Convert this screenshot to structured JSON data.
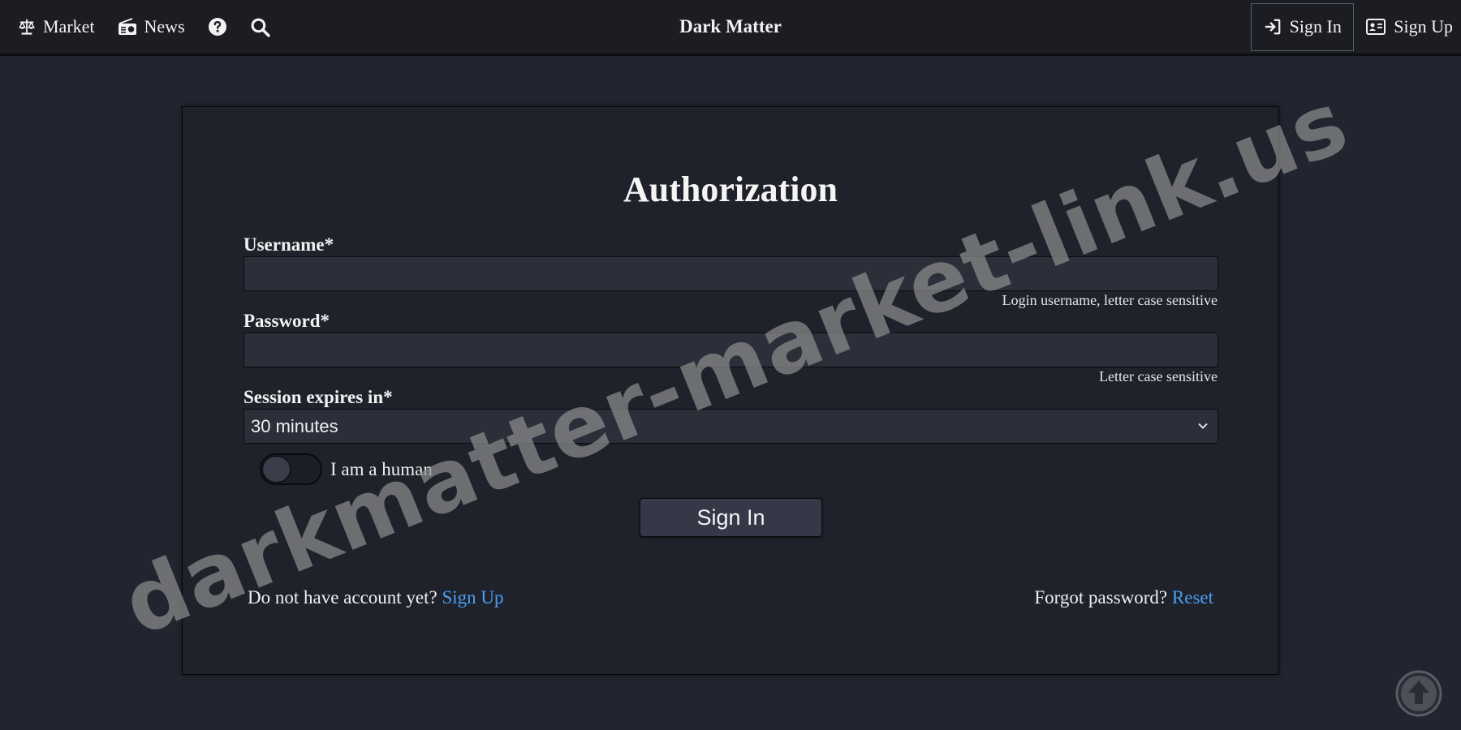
{
  "nav": {
    "market_label": "Market",
    "news_label": "News",
    "brand": "Dark Matter",
    "sign_in_label": "Sign In",
    "sign_up_label": "Sign Up"
  },
  "form": {
    "title": "Authorization",
    "username_label": "Username*",
    "username_value": "",
    "username_hint": "Login username, letter case sensitive",
    "password_label": "Password*",
    "password_value": "",
    "password_hint": "Letter case sensitive",
    "session_label": "Session expires in*",
    "session_selected": "30 minutes",
    "human_toggle_label": "I am a human",
    "human_toggle_on": false,
    "submit_label": "Sign In"
  },
  "footer": {
    "no_account_text": "Do not have account yet?",
    "sign_up_link": "Sign Up",
    "forgot_text": "Forgot password?",
    "reset_link": "Reset"
  },
  "watermark": "darkmatter-market-link.us",
  "colors": {
    "background": "#22252f",
    "topbar": "#1b1d23",
    "card": "#1f222b",
    "input": "#2c2f3a",
    "link": "#4a9ff5"
  },
  "icons": {
    "market": "scale-balance-icon",
    "news": "radio-icon",
    "help": "question-circle-icon",
    "search": "search-icon",
    "sign_in": "sign-in-arrow-icon",
    "sign_up": "id-card-icon",
    "select": "chevron-down-icon",
    "scroll_top": "arrow-up-circle-icon"
  }
}
